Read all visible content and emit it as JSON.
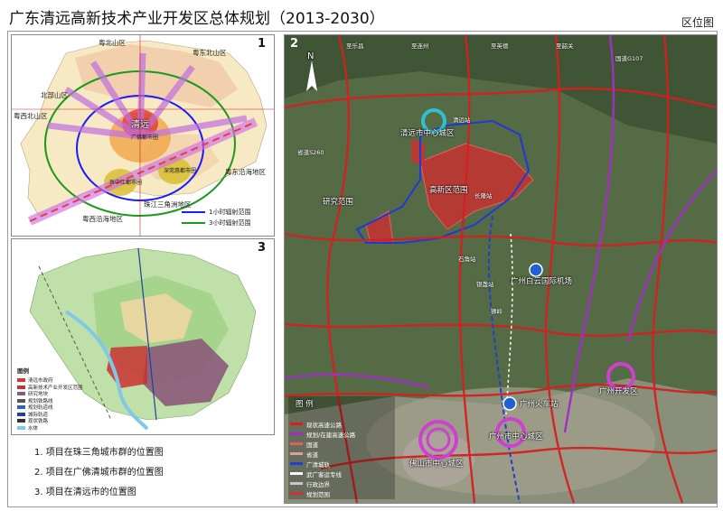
{
  "header": {
    "title": "广东清远高新技术产业开发区总体规划（2013-2030）",
    "badge": "区位图"
  },
  "panel1": {
    "number": "1",
    "labels": {
      "north_mountain": "粤北山区",
      "northeast_mountain": "粤东北山区",
      "northwest_mountain": "北部山区",
      "west_north_mountain": "粤西北山区",
      "east_coast": "粤东沿海地区",
      "west_coast": "粤西沿海地区",
      "delta": "珠江三角洲地区",
      "city": "清远",
      "metro1": "广佛都市圈",
      "metro2": "珠中江都市圈",
      "metro3": "深莞惠都市圈"
    },
    "legend": [
      {
        "label": "1小时辐射范围",
        "color": "#1a1aff"
      },
      {
        "label": "3小时辐射范围",
        "color": "#1a9a1a"
      }
    ]
  },
  "panel3": {
    "number": "3",
    "legend_title": "图例",
    "legend_items": [
      {
        "label": "清远市政府",
        "color": "#e03030"
      },
      {
        "label": "高新技术产业开发区范围",
        "color": "#c83232"
      },
      {
        "label": "研究地块",
        "color": "#8b5a7a"
      },
      {
        "label": "规划铁路线",
        "color": "#555555"
      },
      {
        "label": "规划轨道线",
        "color": "#3060c0"
      },
      {
        "label": "城际轨道",
        "color": "#2040a0"
      },
      {
        "label": "现状铁路",
        "color": "#333333"
      },
      {
        "label": "水体",
        "color": "#80c8e8"
      }
    ]
  },
  "captions": [
    "1. 项目在珠三角城市群的位置图",
    "2. 项目在广佛清城市群的位置图",
    "3. 项目在清远市的位置图"
  ],
  "panel2": {
    "number": "2",
    "labels": {
      "qingyuan_center": "清远市中心城区",
      "qingyuan_station": "清远站",
      "dev_zone": "高新区范围",
      "research_zone": "研究范围",
      "baiyun_airport": "广州白云国际机场",
      "guangzhou_station": "广州火车站",
      "guangzhou_center": "广州市中心城区",
      "foshan_center": "佛山市中心城区",
      "guangzhou_dev": "广州开发区",
      "changlong": "长隆站",
      "small1": "石角站",
      "small2": "银盏站",
      "small3": "狮岭",
      "road1": "国道G107",
      "road2": "省道S260",
      "road3": "至乐昌",
      "road4": "至连州",
      "road5": "至英德",
      "road6": "至韶关"
    },
    "compass_label": "N",
    "legend_title": "图 例",
    "legend": [
      {
        "label": "现状高速公路",
        "color": "#d42020"
      },
      {
        "label": "规划/在建高速公路",
        "color": "#a030c0"
      },
      {
        "label": "国道",
        "color": "#e06060"
      },
      {
        "label": "省道",
        "color": "#e0a0a0"
      },
      {
        "label": "广清城轨",
        "color": "#2040d0"
      },
      {
        "label": "武广客运专线",
        "color": "#ffffff"
      },
      {
        "label": "行政边界",
        "color": "#c8c8c8"
      },
      {
        "label": "规划范围",
        "color": "#d03030"
      }
    ]
  }
}
